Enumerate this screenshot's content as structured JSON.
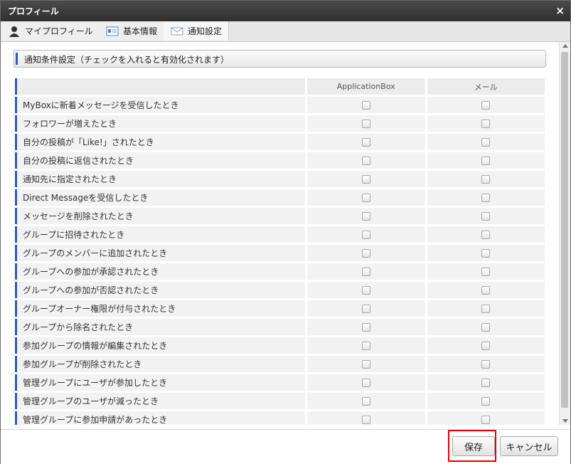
{
  "window": {
    "title": "プロフィール",
    "close_glyph": "×"
  },
  "tabs": [
    {
      "label": "マイプロフィール",
      "icon": "user-icon"
    },
    {
      "label": "基本情報",
      "icon": "id-card-icon"
    },
    {
      "label": "通知設定",
      "icon": "envelope-icon"
    }
  ],
  "section": {
    "title": "通知条件設定（チェックを入れると有効化されます）"
  },
  "columns": {
    "col1": "ApplicationBox",
    "col2": "メール"
  },
  "rows": [
    "MyBoxに新着メッセージを受信したとき",
    "フォロワーが増えたとき",
    "自分の投稿が「Like!」されたとき",
    "自分の投稿に返信されたとき",
    "通知先に指定されたとき",
    "Direct Messageを受信したとき",
    "メッセージを削除されたとき",
    "グループに招待されたとき",
    "グループのメンバーに追加されたとき",
    "グループへの参加が承認されたとき",
    "グループへの参加が否認されたとき",
    "グループオーナー権限が付与されたとき",
    "グループから除名されたとき",
    "参加グループの情報が編集されたとき",
    "参加グループが削除されたとき",
    "管理グループにユーザが参加したとき",
    "管理グループのユーザが減ったとき",
    "管理グループに参加申請があったとき"
  ],
  "buttons": {
    "save": "保存",
    "cancel": "キャンセル"
  },
  "colors": {
    "accent": "#2a5db0",
    "highlight": "#e00000"
  }
}
